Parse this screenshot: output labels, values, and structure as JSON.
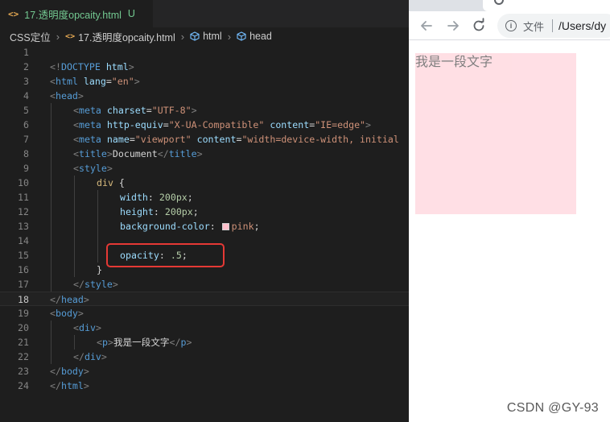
{
  "editor": {
    "tab": {
      "icon": "code-file-icon",
      "title": "17.透明度opcaity.html",
      "status": "U"
    },
    "breadcrumb": {
      "folder": "CSS定位",
      "file": "17.透明度opcaity.html",
      "html": "html",
      "head": "head"
    },
    "current_line": 18,
    "lines": [
      {
        "n": 1,
        "tokens": []
      },
      {
        "n": 2,
        "tokens": [
          [
            "t-punct",
            "<!"
          ],
          [
            "t-doctype",
            "DOCTYPE"
          ],
          [
            "t-plain",
            " "
          ],
          [
            "t-attr",
            "html"
          ],
          [
            "t-punct",
            ">"
          ]
        ]
      },
      {
        "n": 3,
        "tokens": [
          [
            "t-punct",
            "<"
          ],
          [
            "t-tag",
            "html"
          ],
          [
            "t-plain",
            " "
          ],
          [
            "t-attr",
            "lang"
          ],
          [
            "t-plain",
            "="
          ],
          [
            "t-str",
            "\"en\""
          ],
          [
            "t-punct",
            ">"
          ]
        ]
      },
      {
        "n": 4,
        "tokens": [
          [
            "t-punct",
            "<"
          ],
          [
            "t-tag",
            "head"
          ],
          [
            "t-punct",
            ">"
          ]
        ]
      },
      {
        "n": 5,
        "indent": 1,
        "tokens": [
          [
            "t-punct",
            "<"
          ],
          [
            "t-tag",
            "meta"
          ],
          [
            "t-plain",
            " "
          ],
          [
            "t-attr",
            "charset"
          ],
          [
            "t-plain",
            "="
          ],
          [
            "t-str",
            "\"UTF-8\""
          ],
          [
            "t-punct",
            ">"
          ]
        ]
      },
      {
        "n": 6,
        "indent": 1,
        "tokens": [
          [
            "t-punct",
            "<"
          ],
          [
            "t-tag",
            "meta"
          ],
          [
            "t-plain",
            " "
          ],
          [
            "t-attr",
            "http-equiv"
          ],
          [
            "t-plain",
            "="
          ],
          [
            "t-str",
            "\"X-UA-Compatible\""
          ],
          [
            "t-plain",
            " "
          ],
          [
            "t-attr",
            "content"
          ],
          [
            "t-plain",
            "="
          ],
          [
            "t-str",
            "\"IE=edge\""
          ],
          [
            "t-punct",
            ">"
          ]
        ]
      },
      {
        "n": 7,
        "indent": 1,
        "tokens": [
          [
            "t-punct",
            "<"
          ],
          [
            "t-tag",
            "meta"
          ],
          [
            "t-plain",
            " "
          ],
          [
            "t-attr",
            "name"
          ],
          [
            "t-plain",
            "="
          ],
          [
            "t-str",
            "\"viewport\""
          ],
          [
            "t-plain",
            " "
          ],
          [
            "t-attr",
            "content"
          ],
          [
            "t-plain",
            "="
          ],
          [
            "t-str",
            "\"width=device-width, initial"
          ]
        ]
      },
      {
        "n": 8,
        "indent": 1,
        "tokens": [
          [
            "t-punct",
            "<"
          ],
          [
            "t-tag",
            "title"
          ],
          [
            "t-punct",
            ">"
          ],
          [
            "t-plain",
            "Document"
          ],
          [
            "t-punct",
            "</"
          ],
          [
            "t-tag",
            "title"
          ],
          [
            "t-punct",
            ">"
          ]
        ]
      },
      {
        "n": 9,
        "indent": 1,
        "tokens": [
          [
            "t-punct",
            "<"
          ],
          [
            "t-tag",
            "style"
          ],
          [
            "t-punct",
            ">"
          ]
        ]
      },
      {
        "n": 10,
        "indent": 2,
        "tokens": [
          [
            "t-sel",
            "div"
          ],
          [
            "t-plain",
            " {"
          ]
        ]
      },
      {
        "n": 11,
        "indent": 3,
        "tokens": [
          [
            "t-prop",
            "width"
          ],
          [
            "t-plain",
            ": "
          ],
          [
            "t-num",
            "200px"
          ],
          [
            "t-plain",
            ";"
          ]
        ]
      },
      {
        "n": 12,
        "indent": 3,
        "tokens": [
          [
            "t-prop",
            "height"
          ],
          [
            "t-plain",
            ": "
          ],
          [
            "t-num",
            "200px"
          ],
          [
            "t-plain",
            ";"
          ]
        ]
      },
      {
        "n": 13,
        "indent": 3,
        "tokens": [
          [
            "t-prop",
            "background-color"
          ],
          [
            "t-plain",
            ": "
          ],
          [
            "swatch",
            "#ffc0cb"
          ],
          [
            "t-str",
            "pink"
          ],
          [
            "t-plain",
            ";"
          ]
        ]
      },
      {
        "n": 14,
        "indent": 3,
        "tokens": []
      },
      {
        "n": 15,
        "indent": 3,
        "tokens": [
          [
            "t-prop",
            "opacity"
          ],
          [
            "t-plain",
            ": "
          ],
          [
            "t-num",
            ".5"
          ],
          [
            "t-plain",
            ";"
          ]
        ]
      },
      {
        "n": 16,
        "indent": 2,
        "tokens": [
          [
            "t-plain",
            "}"
          ]
        ]
      },
      {
        "n": 17,
        "indent": 1,
        "tokens": [
          [
            "t-punct",
            "</"
          ],
          [
            "t-tag",
            "style"
          ],
          [
            "t-punct",
            ">"
          ]
        ]
      },
      {
        "n": 18,
        "tokens": [
          [
            "t-punct",
            "</"
          ],
          [
            "t-tag",
            "head"
          ],
          [
            "t-punct",
            ">"
          ]
        ]
      },
      {
        "n": 19,
        "tokens": [
          [
            "t-punct",
            "<"
          ],
          [
            "t-tag",
            "body"
          ],
          [
            "t-punct",
            ">"
          ]
        ]
      },
      {
        "n": 20,
        "indent": 1,
        "tokens": [
          [
            "t-punct",
            "<"
          ],
          [
            "t-tag",
            "div"
          ],
          [
            "t-punct",
            ">"
          ]
        ]
      },
      {
        "n": 21,
        "indent": 2,
        "tokens": [
          [
            "t-punct",
            "<"
          ],
          [
            "t-tag",
            "p"
          ],
          [
            "t-punct",
            ">"
          ],
          [
            "t-plain",
            "我是一段文字"
          ],
          [
            "t-punct",
            "</"
          ],
          [
            "t-tag",
            "p"
          ],
          [
            "t-punct",
            ">"
          ]
        ]
      },
      {
        "n": 22,
        "indent": 1,
        "tokens": [
          [
            "t-punct",
            "</"
          ],
          [
            "t-tag",
            "div"
          ],
          [
            "t-punct",
            ">"
          ]
        ]
      },
      {
        "n": 23,
        "tokens": [
          [
            "t-punct",
            "</"
          ],
          [
            "t-tag",
            "body"
          ],
          [
            "t-punct",
            ">"
          ]
        ]
      },
      {
        "n": 24,
        "tokens": [
          [
            "t-punct",
            "</"
          ],
          [
            "t-tag",
            "html"
          ],
          [
            "t-punct",
            ">"
          ]
        ]
      }
    ],
    "highlight_color": "#e53935"
  },
  "browser": {
    "back_icon": "back-arrow-icon",
    "forward_icon": "forward-arrow-icon",
    "reload_icon": "reload-icon",
    "site_info_icon": "info-icon",
    "omnibox_label": "文件",
    "omnibox_url": "/Users/dy",
    "page": {
      "paragraph": "我是一段文字",
      "div_background": "#ffc0cb",
      "div_opacity": 0.5
    }
  },
  "watermark": "CSDN @GY-93"
}
